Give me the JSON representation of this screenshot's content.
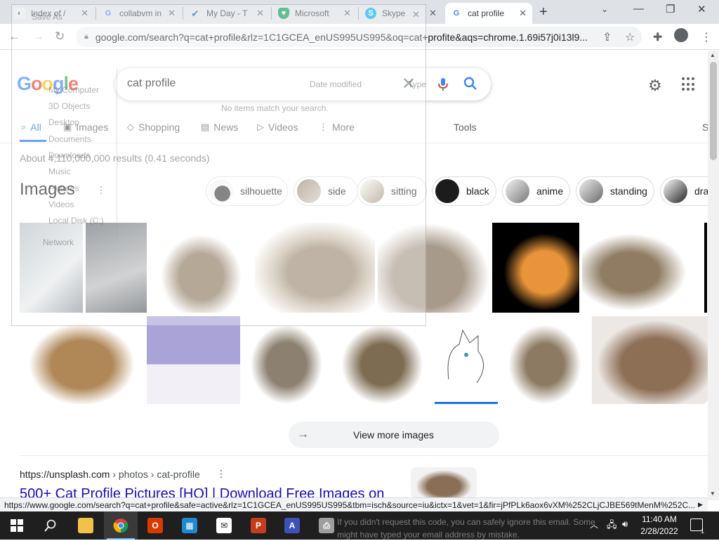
{
  "browser": {
    "tabs": [
      {
        "title": "Index of /",
        "favicon": "index-favicon",
        "color": "#5f6368"
      },
      {
        "title": "collabvm in",
        "favicon": "google-favicon",
        "color": "#4285f4"
      },
      {
        "title": "My Day - T",
        "favicon": "todo-favicon",
        "color": "#2564cf"
      },
      {
        "title": "Microsoft",
        "favicon": "defender-favicon",
        "color": "#0f9d58"
      },
      {
        "title": "Skype",
        "favicon": "skype-favicon",
        "color": "#00aff0"
      },
      {
        "title": "cat profile",
        "favicon": "google-favicon",
        "color": "#4285f4"
      }
    ],
    "new_tab_label": "+",
    "url": "google.com/search?q=cat+profile&rlz=1C1GCEA_enUS995US995&oq=cat+profite&aqs=chrome.1.69i57j0i13l9...."
  },
  "google": {
    "logo_letters": [
      {
        "ch": "G",
        "color": "#4285f4"
      },
      {
        "ch": "o",
        "color": "#ea4335"
      },
      {
        "ch": "o",
        "color": "#fbbc05"
      },
      {
        "ch": "g",
        "color": "#4285f4"
      },
      {
        "ch": "l",
        "color": "#34a853"
      },
      {
        "ch": "e",
        "color": "#ea4335"
      }
    ],
    "query": "cat profile",
    "nav_tabs": [
      "All",
      "Images",
      "Shopping",
      "News",
      "Videos",
      "More"
    ],
    "tools_label": "Tools",
    "truncated_tab": "S",
    "result_stats": "About 4,110,000,000 results (0.41 seconds)",
    "images_heading": "Images",
    "chips": [
      "silhouette",
      "side",
      "sitting",
      "black",
      "anime",
      "standing",
      "draw"
    ],
    "view_more": "View more images",
    "result": {
      "cite_domain": "https://unsplash.com",
      "cite_path": " › photos › cat-profile",
      "title": "500+ Cat Profile Pictures [HQ] | Download Free Images on"
    }
  },
  "status_url": "https://www.google.com/search?q=cat+profile&safe=active&rlz=1C1GCEA_enUS995US995&tbm=isch&source=iu&ictx=1&vet=1&fir=jPfPLk6aox6vXM%252CLjCJBE569tMenM%252C...",
  "ghost_dialog": {
    "title": "Save As",
    "items": [
      "My Computer",
      "3D Objects",
      "Desktop",
      "Documents",
      "Downloads",
      "Music",
      "Pictures",
      "Videos",
      "Local Disk (C:)",
      "Network"
    ],
    "column_header": "Date modified",
    "column_type": "Type",
    "empty_text": "No items match your search."
  },
  "ghost_task_text": [
    "If you didn't request this code, you can safely ignore this email. Some",
    "might have typed your email address by mistake."
  ],
  "taskbar": {
    "apps": [
      "start",
      "search",
      "file-explorer",
      "chrome",
      "office",
      "store",
      "mail",
      "powerpoint",
      "app-a",
      "app-printer"
    ],
    "time": "11:40 AM",
    "date": "2/28/2022",
    "notification_count": "1"
  }
}
